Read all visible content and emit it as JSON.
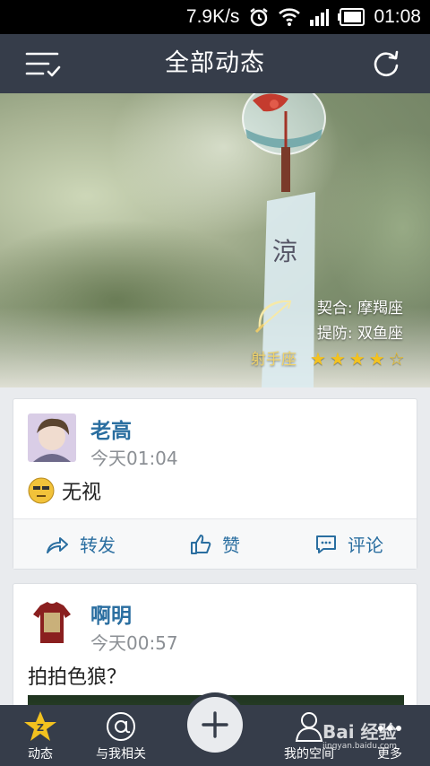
{
  "status_bar": {
    "speed": "7.9K/s",
    "time": "01:08"
  },
  "header": {
    "title": "全部动态"
  },
  "banner": {
    "match_label": "契合: 摩羯座",
    "beware_label": "提防: 双鱼座",
    "sign": "射手座",
    "chime_text": "涼",
    "rating": 4.5
  },
  "posts": [
    {
      "user": "老高",
      "time": "今天01:04",
      "text": "无视"
    },
    {
      "user": "啊明",
      "time": "今天00:57",
      "text": "拍拍色狼？"
    }
  ],
  "actions": {
    "repost": "转发",
    "like": "赞",
    "comment": "评论"
  },
  "tabbar": {
    "feed": "动态",
    "mentions": "与我相关",
    "space": "我的空间",
    "more": "更多"
  },
  "watermark": {
    "brand": "Bai 经验",
    "url": "jingyan.baidu.com"
  },
  "colors": {
    "header": "#363d4a",
    "accent": "#2a6ea0",
    "star": "#f3c21f"
  }
}
